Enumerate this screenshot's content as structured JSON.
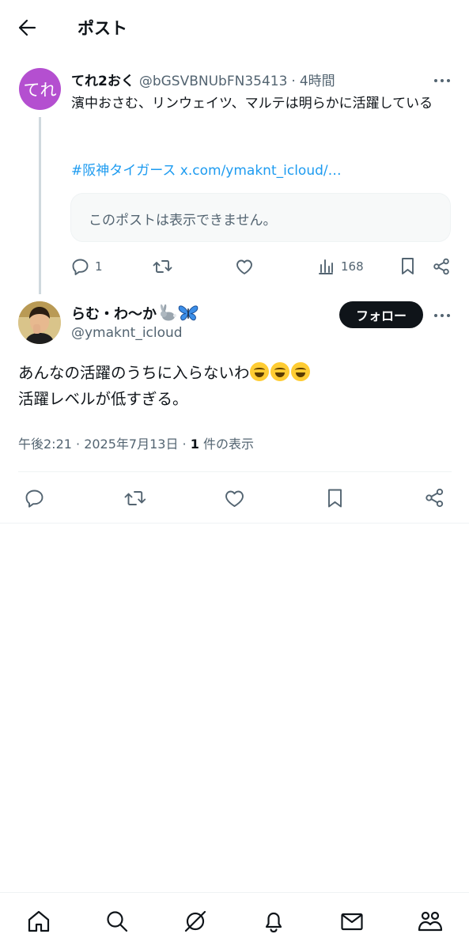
{
  "header": {
    "title": "ポスト"
  },
  "parent_post": {
    "avatar_text": "てれ",
    "display_name": "てれ2おく",
    "handle": "@bGSVBNUbFN35413",
    "separator": "·",
    "time": "4時間",
    "text": "濱中おさむ、リンウェイツ、マルテは明らかに活躍している",
    "link_text": "#阪神タイガース x.com/ymaknt_icloud/…",
    "quote_unavailable": "このポストは表示できません。",
    "reply_count": "1",
    "view_count": "168"
  },
  "main_post": {
    "display_name": "らむ・わ〜か",
    "handle": "@ymaknt_icloud",
    "follow_label": "フォロー",
    "text_line1": "あんなの活躍のうちに入らないわ",
    "text_line2": "活躍レベルが低すぎる。",
    "meta_prefix": "午後2:21 · 2025年7月13日 · ",
    "view_count": "1",
    "view_suffix": " 件の表示"
  },
  "colors": {
    "accent": "#1d9bf0",
    "avatar_purple": "#b44fd0",
    "text": "#0f1419",
    "muted": "#536471"
  },
  "icons": [
    "back-arrow-icon",
    "more-icon",
    "reply-icon",
    "retweet-icon",
    "like-icon",
    "views-icon",
    "bookmark-icon",
    "share-icon",
    "rabbit-icon",
    "butterfly-icon",
    "home-icon",
    "search-icon",
    "grok-icon",
    "notifications-icon",
    "messages-icon",
    "communities-icon"
  ]
}
